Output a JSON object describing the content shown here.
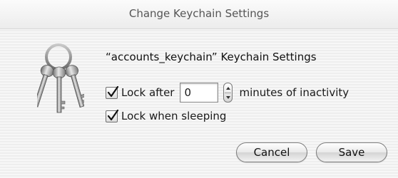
{
  "dialog": {
    "title": "Change Keychain Settings",
    "heading": "“accounts_keychain” Keychain Settings",
    "lock_after": {
      "label": "Lock after",
      "checked": true,
      "value": "0",
      "suffix": "minutes of inactivity"
    },
    "lock_sleep": {
      "label": "Lock when sleeping",
      "checked": true
    },
    "buttons": {
      "cancel": "Cancel",
      "save": "Save"
    },
    "icon": "keychain-keys-icon"
  }
}
